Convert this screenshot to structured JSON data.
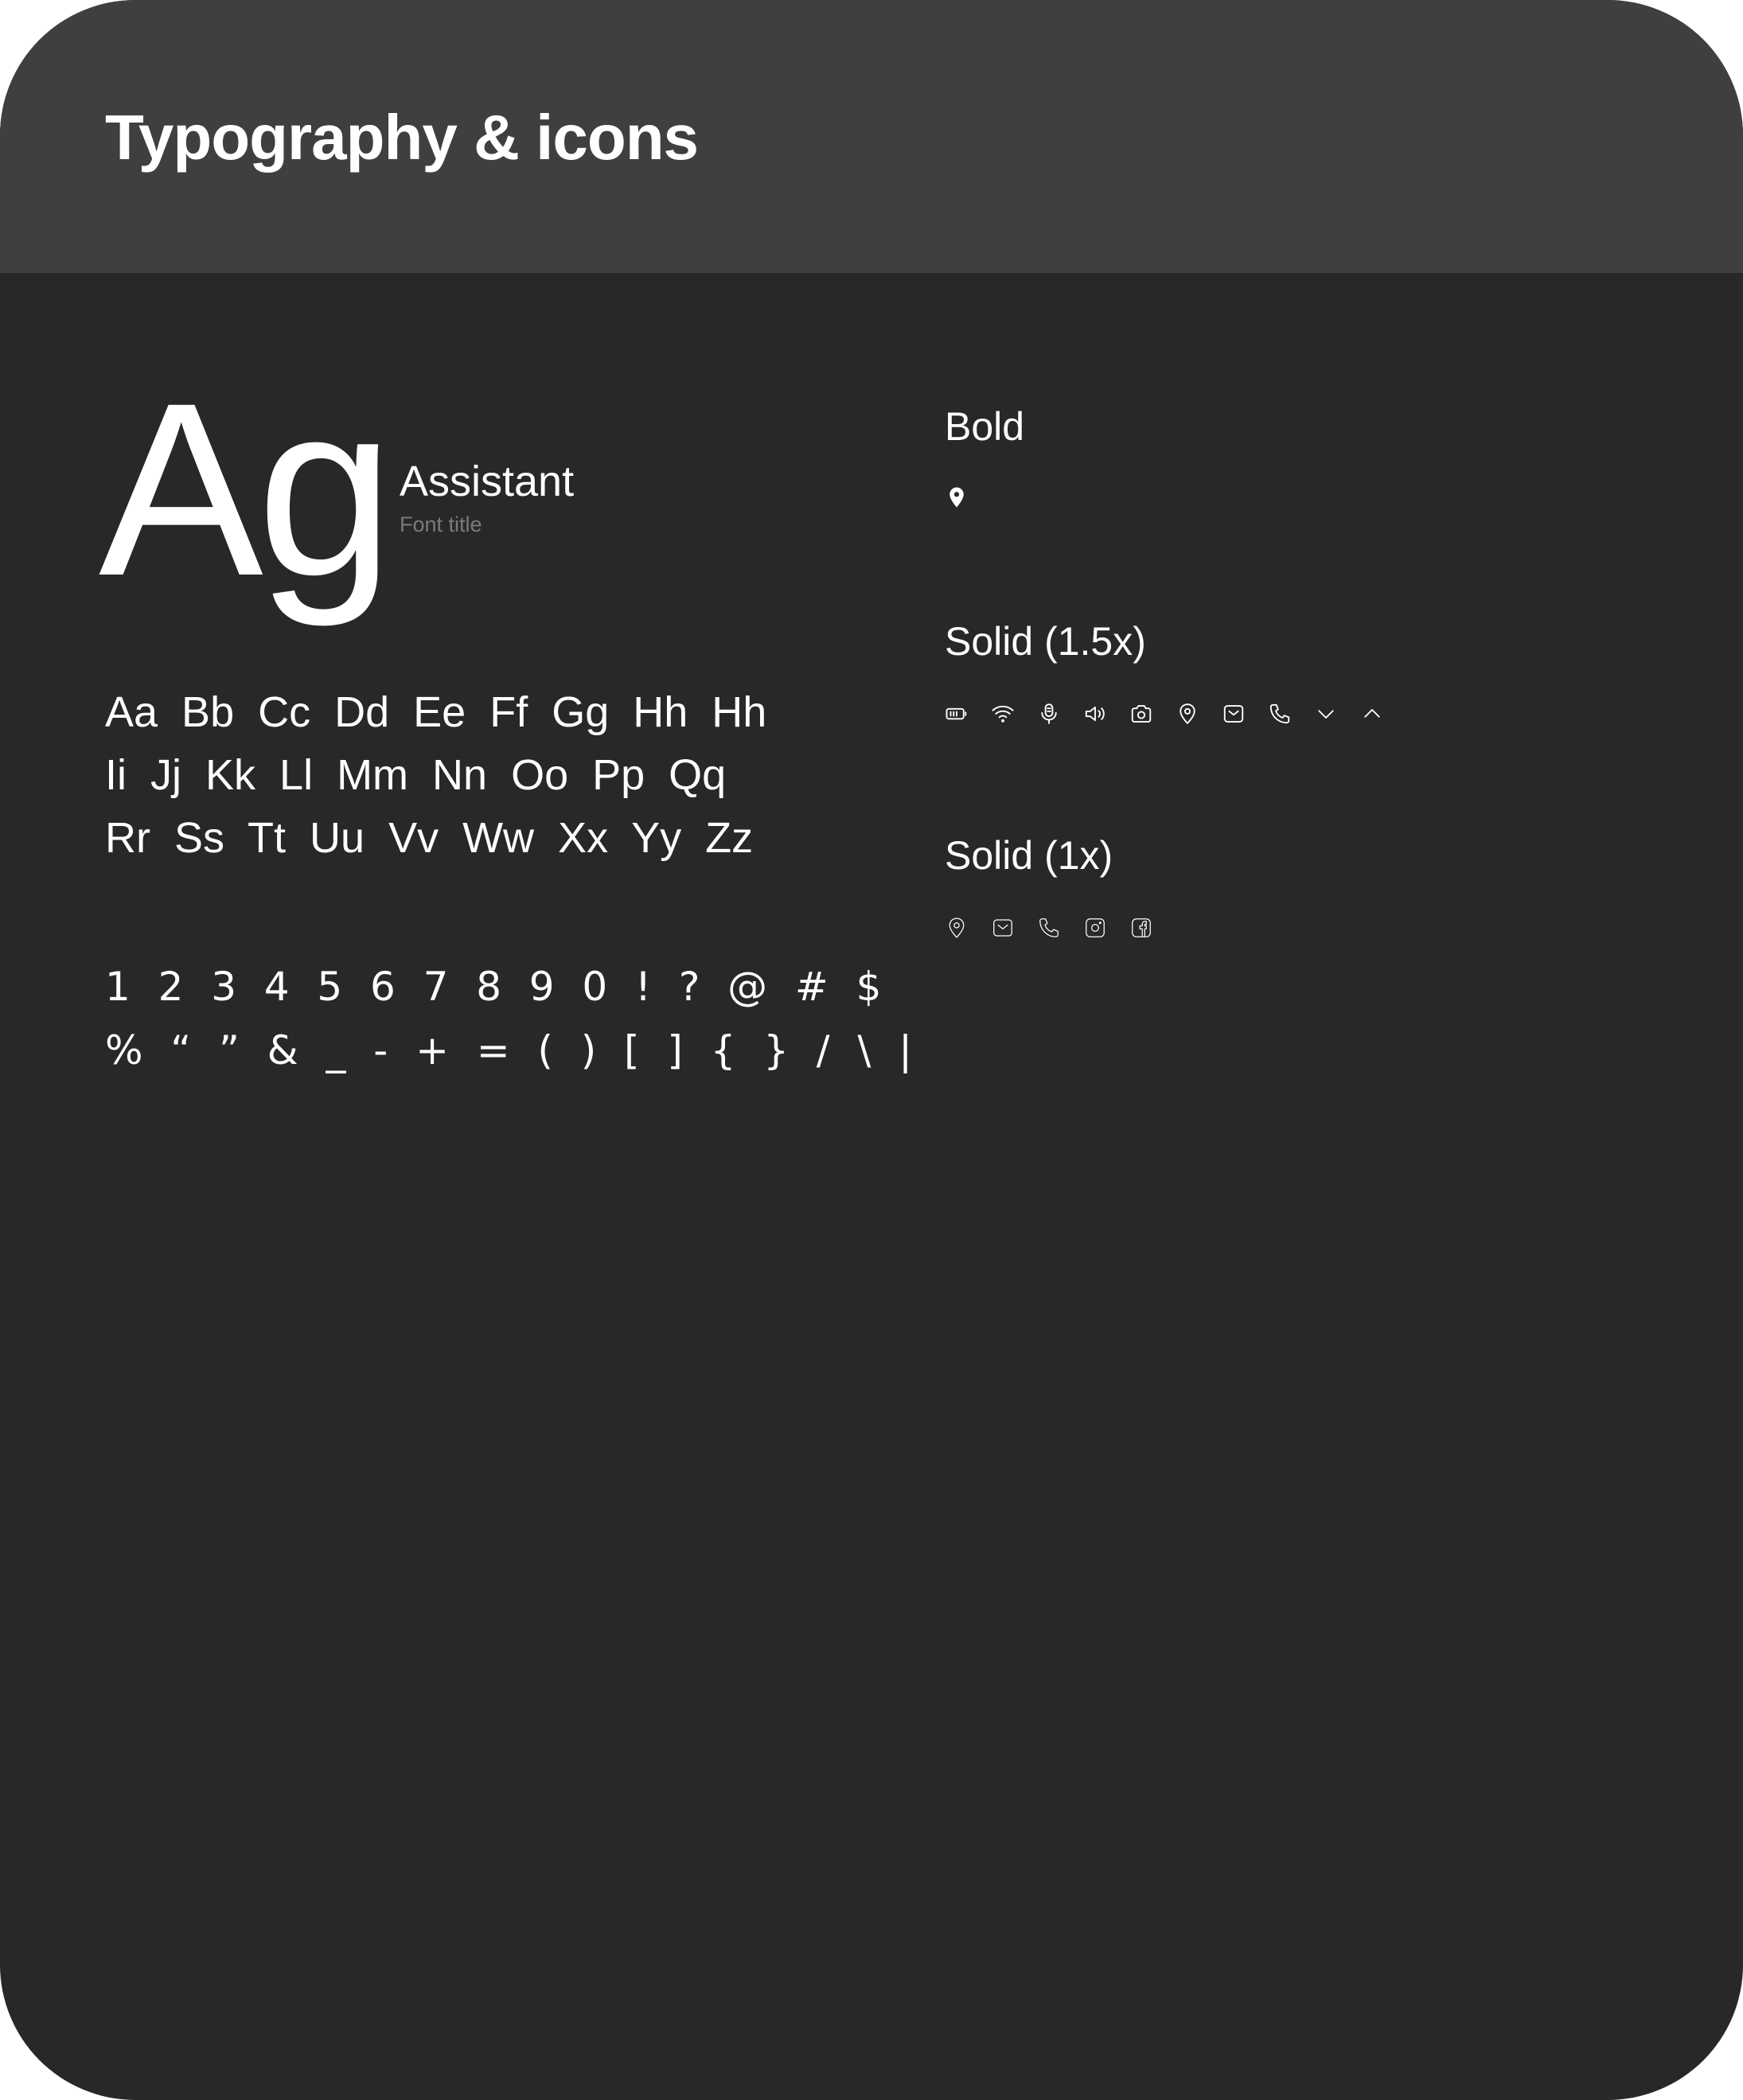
{
  "header": {
    "title": "Typography & icons"
  },
  "font_specimen": {
    "glyph": "Ag",
    "font_name": "Assistant",
    "caption": "Font title"
  },
  "alphabet": {
    "lines": [
      "Aa  Bb  Cc  Dd  Ee  Ff  Gg  Hh  Hh",
      "Ii  Jj  Kk  Ll  Mm  Nn  Oo  Pp  Qq",
      "Rr  Ss  Tt  Uu  Vv  Ww  Xx  Yy  Zz"
    ]
  },
  "symbols": {
    "lines": [
      "1  2  3  4  5  6  7  8  9  0  !  ?  @  #  $",
      "%  “  ”  &  _  -  +  =  (  )  [  ]  {  }  /  \\  |"
    ]
  },
  "icon_sets": {
    "bold": {
      "label": "Bold",
      "icons": [
        "location-pin-icon"
      ]
    },
    "solid_15": {
      "label": "Solid (1.5x)",
      "icons": [
        "battery-icon",
        "wifi-icon",
        "microphone-icon",
        "speaker-icon",
        "camera-icon",
        "location-icon",
        "mail-icon",
        "phone-icon",
        "chevron-down-icon",
        "chevron-up-icon"
      ]
    },
    "solid_1": {
      "label": "Solid (1x)",
      "icons": [
        "location-icon",
        "mail-icon",
        "phone-icon",
        "instagram-icon",
        "facebook-icon"
      ]
    }
  },
  "colors": {
    "background": "#282828",
    "header_background": "#3f3f3f",
    "text": "#ffffff",
    "caption": "#7a7a7a"
  }
}
